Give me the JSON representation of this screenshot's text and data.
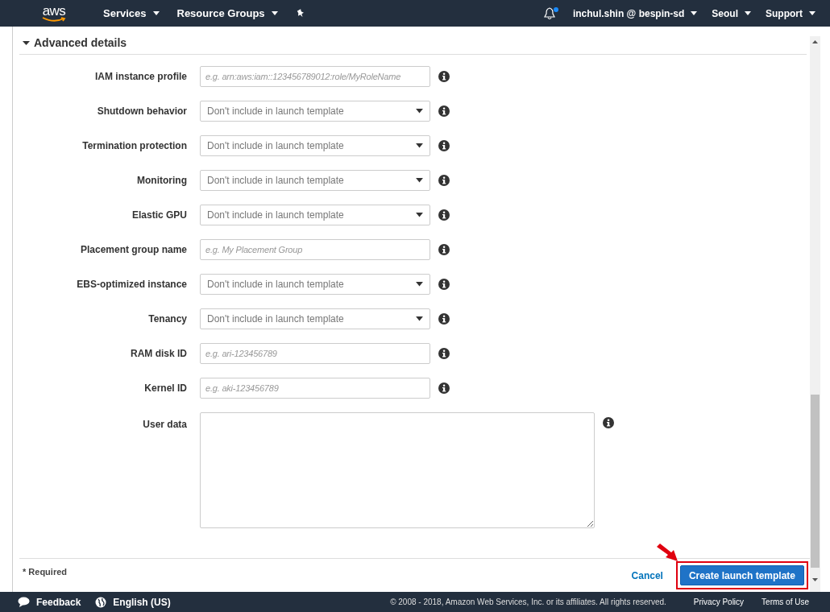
{
  "nav": {
    "logo": "aws",
    "menus_left": [
      "Services",
      "Resource Groups"
    ],
    "notification_unread": true,
    "menus_right": [
      "inchul.shin @ bespin-sd",
      "Seoul",
      "Support"
    ]
  },
  "section": {
    "title": "Advanced details",
    "expanded": true
  },
  "fields": [
    {
      "kind": "text",
      "label": "IAM instance profile",
      "placeholder": "e.g. arn:aws:iam::123456789012:role/MyRoleName"
    },
    {
      "kind": "select",
      "label": "Shutdown behavior",
      "value": "Don't include in launch template"
    },
    {
      "kind": "select",
      "label": "Termination protection",
      "value": "Don't include in launch template"
    },
    {
      "kind": "select",
      "label": "Monitoring",
      "value": "Don't include in launch template"
    },
    {
      "kind": "select",
      "label": "Elastic GPU",
      "value": "Don't include in launch template"
    },
    {
      "kind": "text",
      "label": "Placement group name",
      "placeholder": "e.g. My Placement Group"
    },
    {
      "kind": "select",
      "label": "EBS-optimized instance",
      "value": "Don't include in launch template"
    },
    {
      "kind": "select",
      "label": "Tenancy",
      "value": "Don't include in launch template"
    },
    {
      "kind": "text",
      "label": "RAM disk ID",
      "placeholder": "e.g. ari-123456789"
    },
    {
      "kind": "text",
      "label": "Kernel ID",
      "placeholder": "e.g. aki-123456789"
    },
    {
      "kind": "textarea",
      "label": "User data"
    }
  ],
  "actions": {
    "required_note": "* Required",
    "cancel": "Cancel",
    "submit": "Create launch template",
    "submit_highlighted": true
  },
  "footer": {
    "feedback": "Feedback",
    "language": "English (US)",
    "copyright": "© 2008 - 2018, Amazon Web Services, Inc. or its affiliates. All rights reserved.",
    "links": [
      "Privacy Policy",
      "Terms of Use"
    ]
  }
}
